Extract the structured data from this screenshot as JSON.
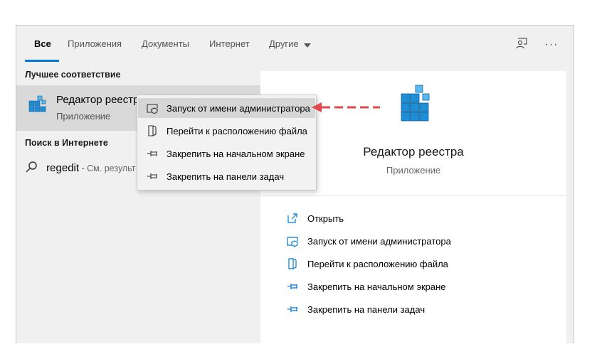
{
  "tabs": [
    {
      "label": "Все"
    },
    {
      "label": "Приложения"
    },
    {
      "label": "Документы"
    },
    {
      "label": "Интернет"
    },
    {
      "label": "Другие"
    }
  ],
  "toolbar": {
    "more_label": "···",
    "feedback_icon": "feedback-person-icon"
  },
  "left": {
    "best_match_title": "Лучшее соответствие",
    "best_match": {
      "title": "Редактор реестра",
      "subtitle": "Приложение",
      "icon": "registry-cubes-icon"
    },
    "web_title": "Поиск в Интернете",
    "web_query": "regedit",
    "web_hint": " - См. результ"
  },
  "context_menu": [
    {
      "label": "Запуск от имени администратора",
      "icon": "shield-icon"
    },
    {
      "label": "Перейти к расположению файла",
      "icon": "file-location-icon"
    },
    {
      "label": "Закрепить на начальном экране",
      "icon": "pin-icon"
    },
    {
      "label": "Закрепить на панели задач",
      "icon": "pin-icon"
    }
  ],
  "detail": {
    "title": "Редактор реестра",
    "subtitle": "Приложение",
    "actions": [
      {
        "label": "Открыть",
        "icon": "open-icon"
      },
      {
        "label": "Запуск от имени администратора",
        "icon": "shield-icon"
      },
      {
        "label": "Перейти к расположению файла",
        "icon": "file-location-icon"
      },
      {
        "label": "Закрепить на начальном экране",
        "icon": "pin-icon"
      },
      {
        "label": "Закрепить на панели задач",
        "icon": "pin-icon"
      }
    ]
  },
  "colors": {
    "accent": "#0078d7",
    "arrow": "#e0474c",
    "highlight": "#d6d6d6"
  }
}
